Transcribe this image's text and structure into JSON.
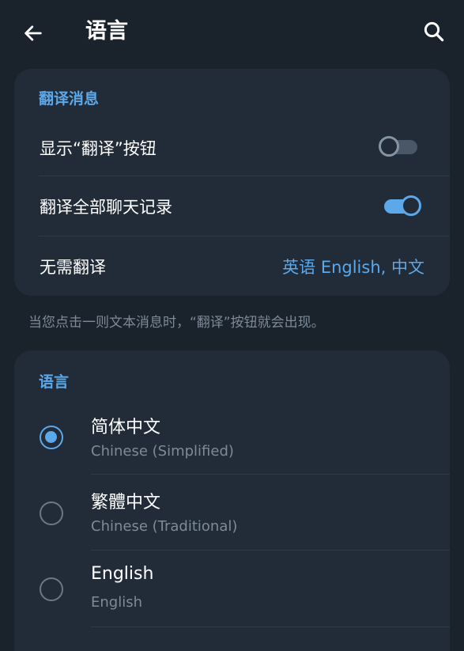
{
  "header": {
    "title": "语言",
    "back_icon": "arrow-left-icon",
    "search_icon": "search-icon"
  },
  "translate_section": {
    "header": "翻译消息",
    "show_translate_button": {
      "label": "显示“翻译”按钮",
      "enabled": false
    },
    "translate_all_chats": {
      "label": "翻译全部聊天记录",
      "enabled": true
    },
    "do_not_translate": {
      "label": "无需翻译",
      "value": "英语 English, 中文"
    },
    "footer_note": "当您点击一则文本消息时，“翻译”按钮就会出现。"
  },
  "language_section": {
    "header": "语言",
    "languages": [
      {
        "name": "简体中文",
        "subtitle": "Chinese (Simplified)",
        "selected": true
      },
      {
        "name": "繁體中文",
        "subtitle": "Chinese (Traditional)",
        "selected": false
      },
      {
        "name": "English",
        "subtitle": "English",
        "selected": false
      }
    ]
  },
  "colors": {
    "background": "#1a222c",
    "card": "#222c38",
    "accent": "#5ba8ea",
    "secondary_text": "#7d8a97"
  }
}
